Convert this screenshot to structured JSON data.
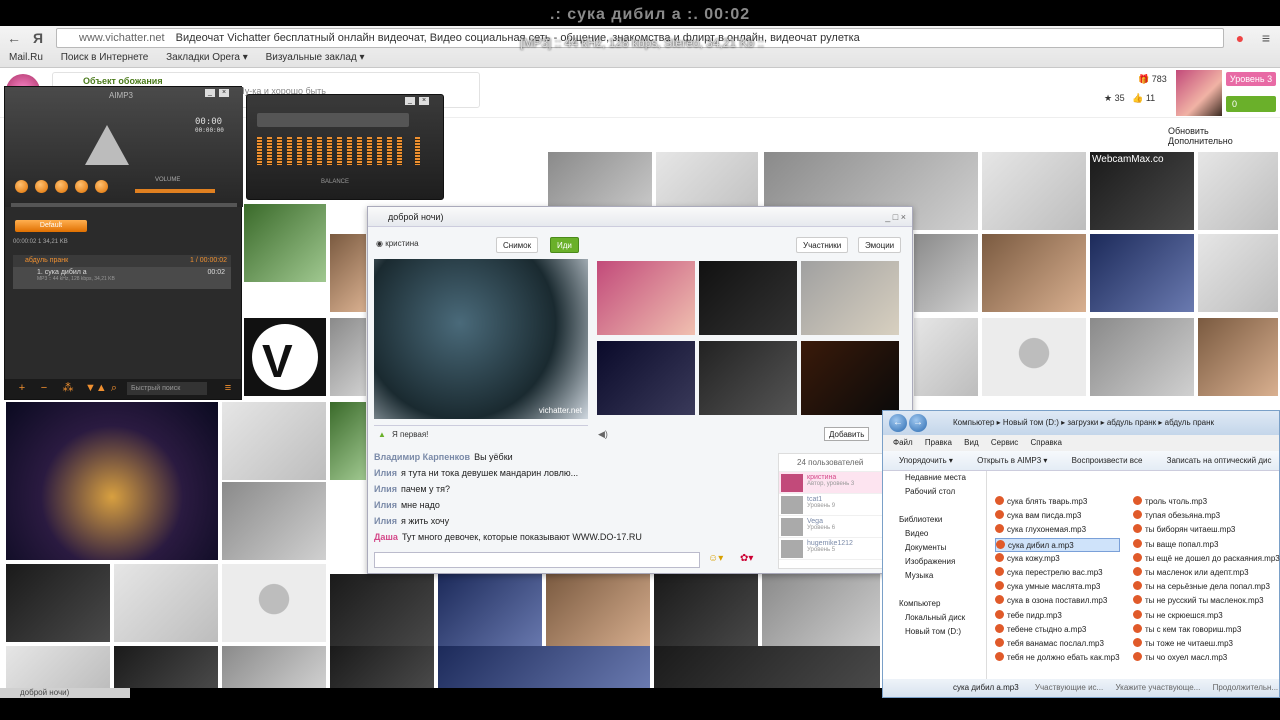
{
  "video": {
    "title": ".: сука дибил а :. 00:02",
    "track_info": "[MP3] :: 44 kHz, 128 kbps, Stereo, 34,21 Kb ::"
  },
  "browser": {
    "url": "www.vichatter.net",
    "page_title": "Видеочат Vichatter бесплатный онлайн видеочат, Видео социальная сеть - общение, знакомства и флирт в онлайн, видеочат рулетка",
    "bookmarks": [
      "Mail.Ru",
      "Поиск в Интернете",
      "Закладки Opera ▾",
      "Визуальные заклад ▾"
    ]
  },
  "site": {
    "notice_title": "Объект обожания",
    "notice_text": "...цените ваше внимание поварном? Ну-ка и хорошо быть",
    "stats": {
      "gifts": "783",
      "stars": "35",
      "likes": "11"
    },
    "level": "Уровень 3",
    "coins": "0",
    "refresh": "Обновить",
    "more": "Дополнительно",
    "webcam_logo": "WebcamMax.co"
  },
  "aimp": {
    "title": "AIMP3",
    "time": "00:00",
    "time_sub": "00:00:00",
    "volume_label": "VOLUME",
    "default_tab": "Default",
    "info": "00:00:02   1   34,21 KB",
    "group": "абдуль пранк",
    "group_count": "1 / 00:00:02",
    "track": "1. сука дибил а",
    "track_sub": "MP3 :: 44 kHz, 128 kbps, 34,21 KB",
    "track_dur": "00:02",
    "search": "Быстрый поиск",
    "balance_label": "BALANCE"
  },
  "chat": {
    "title": "доброй ночи)",
    "user": "кристина",
    "snapshot": "Снимок",
    "go": "Иди",
    "participants": "Участники",
    "emotions": "Эмоции",
    "watermark": "vichatter.net",
    "first": "Я первая!",
    "add": "Добавить",
    "messages": [
      {
        "who": "Владимир Карпенков",
        "text": "Вы уёбки",
        "pink": false
      },
      {
        "who": "Илия",
        "text": "я тута ни тока девушек мандарин ловлю...",
        "pink": false
      },
      {
        "who": "Илия",
        "text": "пачем у тя?",
        "pink": false
      },
      {
        "who": "Илия",
        "text": "мне надо",
        "pink": false
      },
      {
        "who": "Илия",
        "text": "я жить хочу",
        "pink": false
      },
      {
        "who": "Даша",
        "text": "Тут много девочек, которые показывают WWW.DO-17.RU",
        "pink": true
      }
    ],
    "users_count": "24 пользователей",
    "users": [
      {
        "name": "кристина",
        "sub": "Автор, уровень 3"
      },
      {
        "name": "tcat1",
        "sub": "Уровень 9"
      },
      {
        "name": "Vega",
        "sub": "Уровень 6"
      },
      {
        "name": "hugemike1212",
        "sub": "Уровень 5"
      }
    ]
  },
  "explorer": {
    "path": "Компьютер ▸ Новый том (D:) ▸ загрузки ▸ абдуль пранк ▸ абдуль пранк",
    "menu": [
      "Файл",
      "Правка",
      "Вид",
      "Сервис",
      "Справка"
    ],
    "tools": [
      "Упорядочить ▾",
      "Открыть в AIMP3 ▾",
      "Воспроизвести все",
      "Записать на оптический дис"
    ],
    "nav": [
      "Недавние места",
      "Рабочий стол",
      "",
      "Библиотеки",
      "Видео",
      "Документы",
      "Изображения",
      "Музыка",
      "",
      "Компьютер",
      "Локальный диск",
      "Новый том (D:)"
    ],
    "files_left": [
      "сука блять тварь.mp3",
      "сука вам писда.mp3",
      "сука глухонемая.mp3",
      "сука дибил а.mp3",
      "сука кожу.mp3",
      "сука перестрелю вас.mp3",
      "сука умные маслята.mp3",
      "сука в озона поставил.mp3",
      "тебе пидр.mp3",
      "тебене стыдно а.mp3",
      "тебя ванамас послал.mp3",
      "тебя не должно ебать как.mp3"
    ],
    "files_right": [
      "троль чтоль.mp3",
      "тупая обезьяна.mp3",
      "ты биборян читаеш.mp3",
      "ты ваще попал.mp3",
      "ты ещё не дошел до раскаяния.mp3",
      "ты масленок или адепт.mp3",
      "ты на серьёзные дела попал.mp3",
      "ты не русский ты масленок.mp3",
      "ты не скрюешся.mp3",
      "ты с кем так говориш.mp3",
      "ты тоже не читаеш.mp3",
      "ты чо охуел масл.mp3"
    ],
    "selected": "сука дибил а.mp3",
    "status_name": "сука дибил а.mp3",
    "status_1": "Участвующие ис...",
    "status_2": "Укажите участвующе...",
    "status_3": "Продолжительн..."
  },
  "taskbar": {
    "item": "доброй ночи)"
  }
}
